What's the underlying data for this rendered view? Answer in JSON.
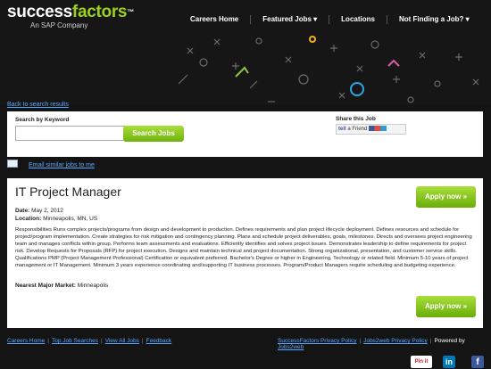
{
  "brand": {
    "name_a": "success",
    "name_b": "factors",
    "tm": "™",
    "sub": "An SAP Company"
  },
  "nav": [
    {
      "label": "Careers Home"
    },
    {
      "label": "Featured Jobs ▾"
    },
    {
      "label": "Locations"
    },
    {
      "label": "Not Finding a Job? ▾"
    }
  ],
  "back_link": "Back to search results",
  "search": {
    "label": "Search by Keyword",
    "value": "",
    "button": "Search Jobs"
  },
  "share": {
    "label": "Share this Job",
    "tell": "tell",
    "a_friend": "a Friend"
  },
  "email_link": "Email similar jobs to me",
  "job": {
    "title": "IT Project Manager",
    "date_label": "Date:",
    "date": "May 2, 2012",
    "location_label": "Location:",
    "location": "Minneapolis, MN, US",
    "description": "Responsibilities Runs complex projects/programs from design and development to production. Defines requirements and plan project lifecycle deployment. Defines resources and schedule for project/program implementation. Create strategies for risk mitigation and contingency planning. Plans and schedule project deliverables, goals, milestones. Directs and oversees project engineering team and manages conflicts within group. Performs team assessments and evaluations. Efficiently identifies and solves project issues. Demonstrates leadership to define requirements for project risk. Develop Requests for Proposals (RFP) for project execution. Designs and maintain technical and project documentation. Strong organizational, presentation, and customer service skills. Qualifications PMP (Project Management Professional) Certification or equivalent preferred. Bachelor's Degree or higher in Engineering, Technology or related field. Minimum 5-10 years of project management or IT Management. Minimum 3 years experience coordinating and/supporting IT business processes. Program/Product Managers require scheduling and budgeting experience.",
    "market_label": "Nearest Major Market:",
    "market": "Minneapolis",
    "apply": "Apply now »"
  },
  "footer": {
    "links": [
      "Careers Home",
      "Top Job Searches",
      "View All Jobs",
      "Feedback"
    ],
    "privacy": "SuccessFactors Privacy Policy",
    "jobs2web_privacy": "Jobs2web Privacy Policy",
    "powered": "Powered by",
    "jobs2web": "Jobs2web"
  },
  "social": {
    "pinterest": "Pin it",
    "linkedin": "in",
    "facebook": "f"
  },
  "colors": {
    "accent_green": "#8cc63f",
    "link_blue": "#5aa7ff",
    "bg": "#141414"
  }
}
